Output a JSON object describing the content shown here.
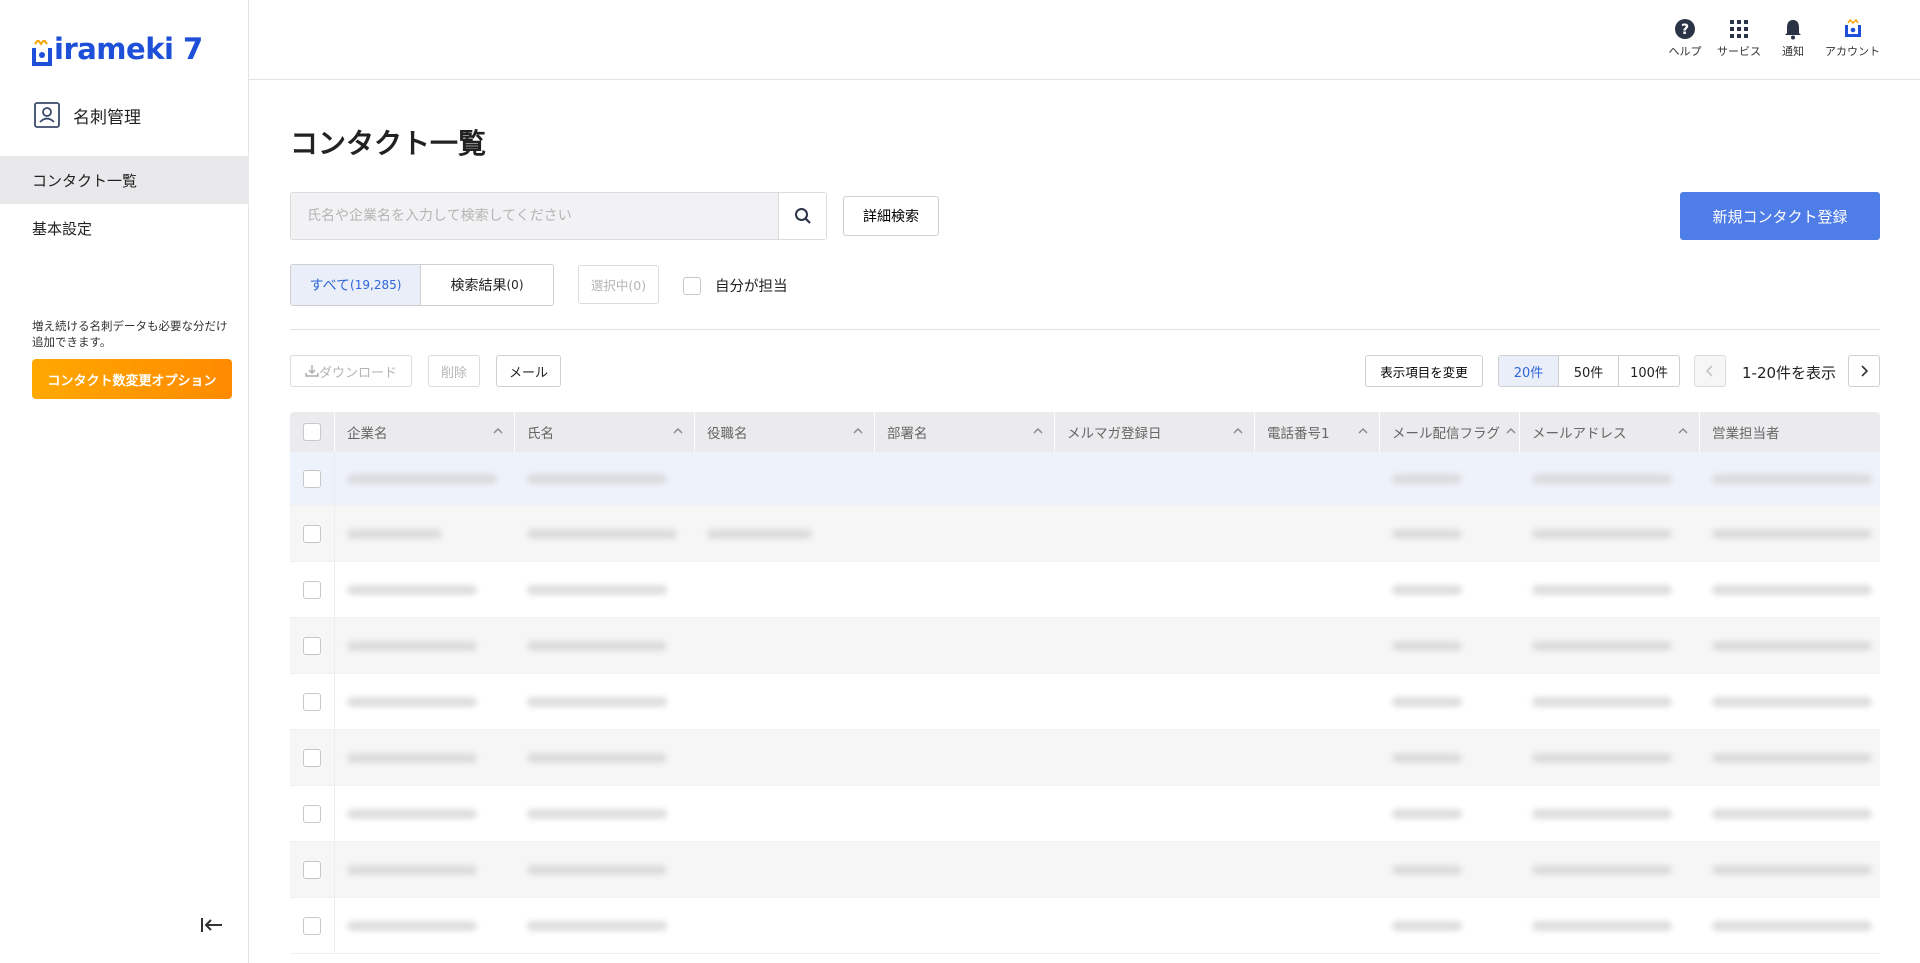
{
  "brand": {
    "logo_text": "irameki 7",
    "logo_initial": "H",
    "accent": "#1d4fd8"
  },
  "sidebar": {
    "app_title": "名刺管理",
    "items": [
      {
        "label": "コンタクト一覧",
        "active": true
      },
      {
        "label": "基本設定",
        "active": false
      }
    ],
    "promo_text": "増え続ける名刺データも必要な分だけ追加できます。",
    "promo_button": "コンタクト数変更オプション"
  },
  "header": {
    "icons": [
      {
        "label": "ヘルプ",
        "icon": "help-icon"
      },
      {
        "label": "サービス",
        "icon": "grid-icon"
      },
      {
        "label": "通知",
        "icon": "bell-icon"
      },
      {
        "label": "アカウント",
        "icon": "account-icon"
      }
    ]
  },
  "main": {
    "title": "コンタクト一覧",
    "search": {
      "placeholder": "氏名や企業名を入力して検索してください",
      "value": ""
    },
    "advanced_search": "詳細検索",
    "new_contact": "新規コンタクト登録",
    "filters": {
      "all_label": "すべて",
      "all_count": "(19,285)",
      "result_label": "検索結果",
      "result_count": "(0)",
      "selected": "選択中(0)",
      "mine": "自分が担当"
    },
    "toolbar": {
      "download": "ダウンロード",
      "delete": "削除",
      "mail": "メール",
      "columns": "表示項目を変更",
      "page_sizes": [
        "20件",
        "50件",
        "100件"
      ],
      "range": "1-20件を表示"
    },
    "table": {
      "columns": [
        "企業名",
        "氏名",
        "役職名",
        "部署名",
        "メルマガ登録日",
        "電話番号1",
        "メール配信フラグ",
        "メールアドレス",
        "営業担当者"
      ],
      "visible_rows": 9
    }
  }
}
